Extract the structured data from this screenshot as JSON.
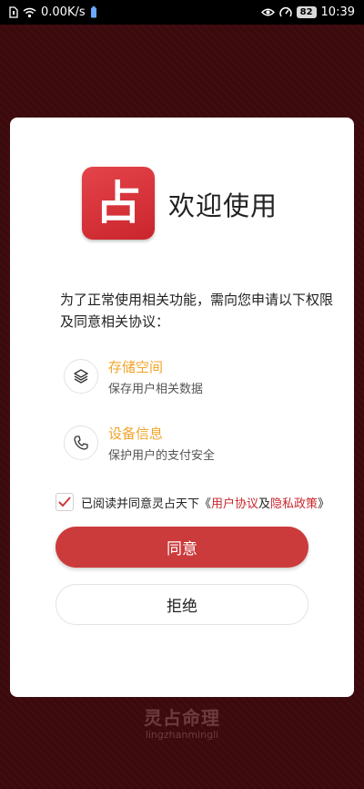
{
  "status_bar": {
    "net_speed": "0.00K/s",
    "battery": "82",
    "time": "10:39"
  },
  "dialog": {
    "logo_char": "占",
    "welcome": "欢迎使用",
    "intro": "为了正常使用相关功能，需向您申请以下权限及同意相关协议：",
    "permissions": [
      {
        "icon": "layers-icon",
        "title": "存储空间",
        "desc": "保存用户相关数据"
      },
      {
        "icon": "phone-icon",
        "title": "设备信息",
        "desc": "保护用户的支付安全"
      }
    ],
    "agreement": {
      "checked": true,
      "prefix": "已阅读并同意灵占天下《",
      "user_agreement": "用户协议",
      "middle": "及",
      "privacy_policy": "隐私政策",
      "suffix": "》"
    },
    "agree_button": "同意",
    "refuse_button": "拒绝"
  },
  "branding": {
    "name": "灵占命理",
    "sub": "lingzhanmingli"
  },
  "colors": {
    "accent": "#cc3b3c",
    "permission_title": "#f0a52a",
    "background": "#3c0a0d"
  }
}
